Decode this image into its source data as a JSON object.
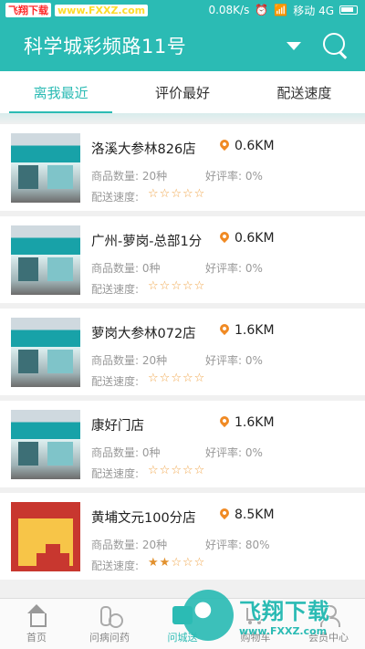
{
  "status_bar": {
    "site_label": "飞翔下载",
    "site_url": "www.FXXZ.com",
    "speed": "0.08K/s",
    "carrier": "移动 4G"
  },
  "header": {
    "title": "科学城彩频路11号"
  },
  "tabs": [
    {
      "label": "离我最近",
      "active": true
    },
    {
      "label": "评价最好",
      "active": false
    },
    {
      "label": "配送速度",
      "active": false
    }
  ],
  "labels": {
    "count": "商品数量:",
    "rate": "好评率:",
    "speed": "配送速度:"
  },
  "stores": [
    {
      "name": "洛溪大参林826店",
      "distance": "0.6KM",
      "count": "20种",
      "rate": "0%",
      "stars": 0
    },
    {
      "name": "广州-萝岗-总部1分",
      "distance": "0.6KM",
      "count": "0种",
      "rate": "0%",
      "stars": 0
    },
    {
      "name": "萝岗大参林072店",
      "distance": "1.6KM",
      "count": "20种",
      "rate": "0%",
      "stars": 0
    },
    {
      "name": "康好门店",
      "distance": "1.6KM",
      "count": "0种",
      "rate": "0%",
      "stars": 0
    },
    {
      "name": "黄埔文元100分店",
      "distance": "8.5KM",
      "count": "20种",
      "rate": "80%",
      "stars": 2
    }
  ],
  "bottom_nav": [
    {
      "label": "首页",
      "icon": "home-icon",
      "active": false
    },
    {
      "label": "问病问药",
      "icon": "pill-icon",
      "active": false
    },
    {
      "label": "问城送",
      "icon": "shop-icon",
      "active": true
    },
    {
      "label": "购物车",
      "icon": "cart-icon",
      "active": false
    },
    {
      "label": "会员中心",
      "icon": "user-icon",
      "active": false
    }
  ],
  "watermark": {
    "name": "飞翔下载",
    "url": "www.FXXZ.com"
  },
  "colors": {
    "accent": "#2bbbb4",
    "star": "#e2912e"
  }
}
